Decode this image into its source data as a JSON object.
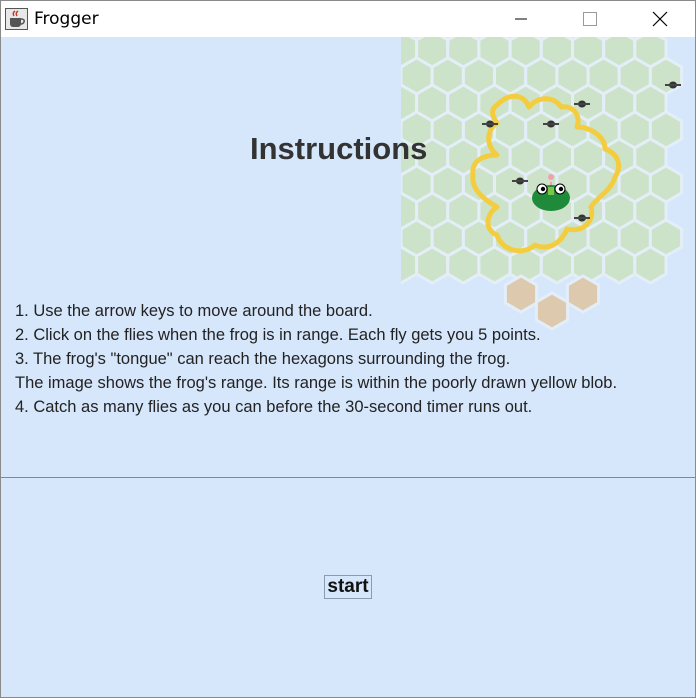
{
  "window": {
    "title": "Frogger"
  },
  "instructions": {
    "heading": "Instructions",
    "lines": [
      "1. Use the arrow keys to move around the board.",
      "2. Click on the flies when the frog is in range. Each fly gets you 5 points.",
      "3. The frog's \"tongue\" can reach the hexagons surrounding the frog.",
      "The image shows the frog's range. Its range is within the poorly drawn yellow blob.",
      "4. Catch as many flies as you can before the 30-second timer runs out."
    ]
  },
  "controls": {
    "start_label": "start"
  },
  "colors": {
    "panel_background": "#d6e7fb",
    "hex_green": "#cde3c9",
    "hex_tan": "#ddc9ad",
    "range_blob": "#f3cd3f",
    "frog": "#1e8a3a",
    "fly": "#333333"
  },
  "icons": {
    "app": "java-cup-icon",
    "minimize": "minimize-icon",
    "maximize": "maximize-icon",
    "close": "close-icon"
  }
}
